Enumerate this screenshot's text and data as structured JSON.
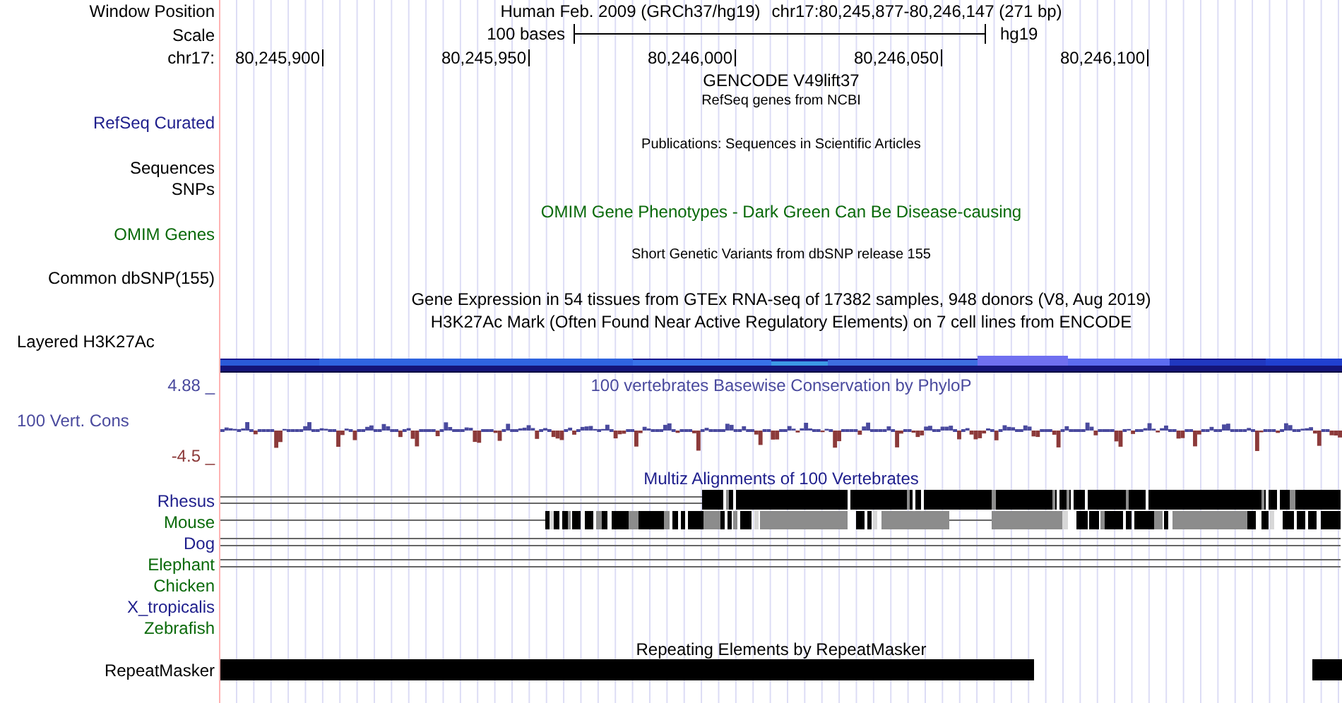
{
  "lines": [
    {
      "kind": "header",
      "label": "Window Position",
      "assembly": "Human Feb. 2009 (GRCh37/hg19)",
      "position": "chr17:80,245,877-80,246,147 (271 bp)"
    },
    {
      "kind": "scale",
      "label": "Scale",
      "length": "100 bases",
      "assembly": "hg19"
    },
    {
      "kind": "ruler",
      "label": "chr17:",
      "ticks": [
        "80,245,900",
        "80,245,950",
        "80,246,000",
        "80,246,050",
        "80,246,100"
      ]
    },
    {
      "kind": "title",
      "text": "GENCODE V49lift37",
      "color": "#000000"
    },
    {
      "kind": "small",
      "text": "RefSeq genes from NCBI",
      "color": "#000000"
    },
    {
      "kind": "label",
      "label": "RefSeq Curated",
      "color": "#1e1e8c"
    },
    {
      "kind": "small",
      "text": "Publications: Sequences in Scientific Articles",
      "color": "#000000"
    },
    {
      "kind": "label",
      "label": "Sequences",
      "color": "#000000"
    },
    {
      "kind": "label",
      "label": "SNPs",
      "color": "#000000"
    },
    {
      "kind": "title",
      "text": "OMIM Gene Phenotypes - Dark Green Can Be Disease-causing",
      "color": "#0a6a0a"
    },
    {
      "kind": "label",
      "label": "OMIM Genes",
      "color": "#0a6a0a"
    },
    {
      "kind": "small",
      "text": "Short Genetic Variants from dbSNP release 155",
      "color": "#000000"
    },
    {
      "kind": "label",
      "label": "Common dbSNP(155)",
      "color": "#000000"
    },
    {
      "kind": "title",
      "text": "Gene Expression in 54 tissues from GTEx RNA-seq of 17382 samples, 948 donors (V8, Aug 2019)",
      "color": "#000000"
    },
    {
      "kind": "title",
      "text": "H3K27Ac Mark (Often Found Near Active Regulatory Elements) on 7 cell lines from ENCODE",
      "color": "#000000"
    },
    {
      "kind": "wiggle-label",
      "label": "Layered H3K27Ac",
      "color": "#000000"
    },
    {
      "kind": "layered"
    },
    {
      "kind": "wiggle-top",
      "label": "4.88 _",
      "text": "100 vertebrates Basewise Conservation by PhyloP",
      "color": "#4a4a9e"
    },
    {
      "kind": "conservation",
      "label": "100 Vert. Cons",
      "color": "#4a4a9e",
      "min": {
        "text": "-4.5 _",
        "color": "#8c3a3a"
      }
    },
    {
      "kind": "title",
      "text": "Multiz Alignments of 100 Vertebrates",
      "color": "#1e1e8c"
    },
    {
      "kind": "species",
      "label": "Rhesus",
      "color": "#1e1e8c"
    },
    {
      "kind": "species",
      "label": "Mouse",
      "color": "#0a6a0a"
    },
    {
      "kind": "species",
      "label": "Dog",
      "color": "#1e1e8c"
    },
    {
      "kind": "species",
      "label": "Elephant",
      "color": "#0a6a0a"
    },
    {
      "kind": "species",
      "label": "Chicken",
      "color": "#0a6a0a"
    },
    {
      "kind": "species",
      "label": "X_tropicalis",
      "color": "#1e1e8c"
    },
    {
      "kind": "species",
      "label": "Zebrafish",
      "color": "#0a6a0a"
    },
    {
      "kind": "title",
      "text": "Repeating Elements by RepeatMasker",
      "color": "#000000"
    },
    {
      "kind": "repeat",
      "label": "RepeatMasker",
      "color": "#000000"
    }
  ]
}
